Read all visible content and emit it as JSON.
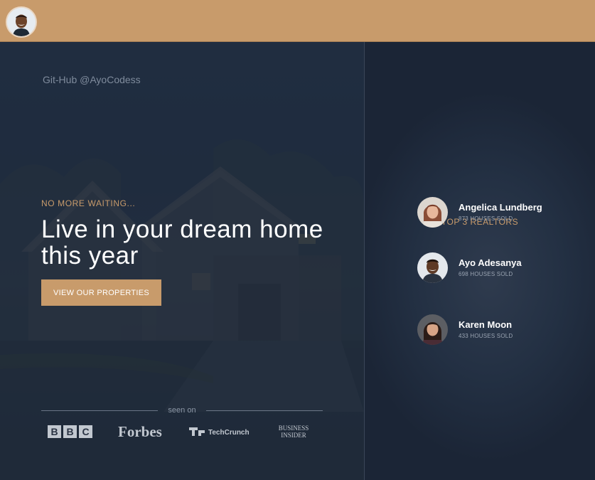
{
  "header": {
    "avatar_icon": "user-avatar-icon",
    "bar_color": "#c89b6b"
  },
  "hero": {
    "github": "Git-Hub @AyoCodess",
    "eyebrow": "NO MORE WAITING...",
    "headline": "Live in your dream home this year",
    "cta_label": "VIEW OUR PROPERTIES",
    "seen_on": "seen on",
    "press_logos": [
      "BBC",
      "Forbes",
      "TechCrunch",
      "Business Insider"
    ],
    "accent_color": "#c89b6b"
  },
  "sidebar": {
    "title": "TOP 3 REALTORS",
    "realtors": [
      {
        "name": "Angelica Lundberg",
        "sold": "873 HOUSES SOLD"
      },
      {
        "name": "Ayo Adesanya",
        "sold": "698 HOUSES SOLD"
      },
      {
        "name": "Karen Moon",
        "sold": "433 HOUSES SOLD"
      }
    ]
  }
}
